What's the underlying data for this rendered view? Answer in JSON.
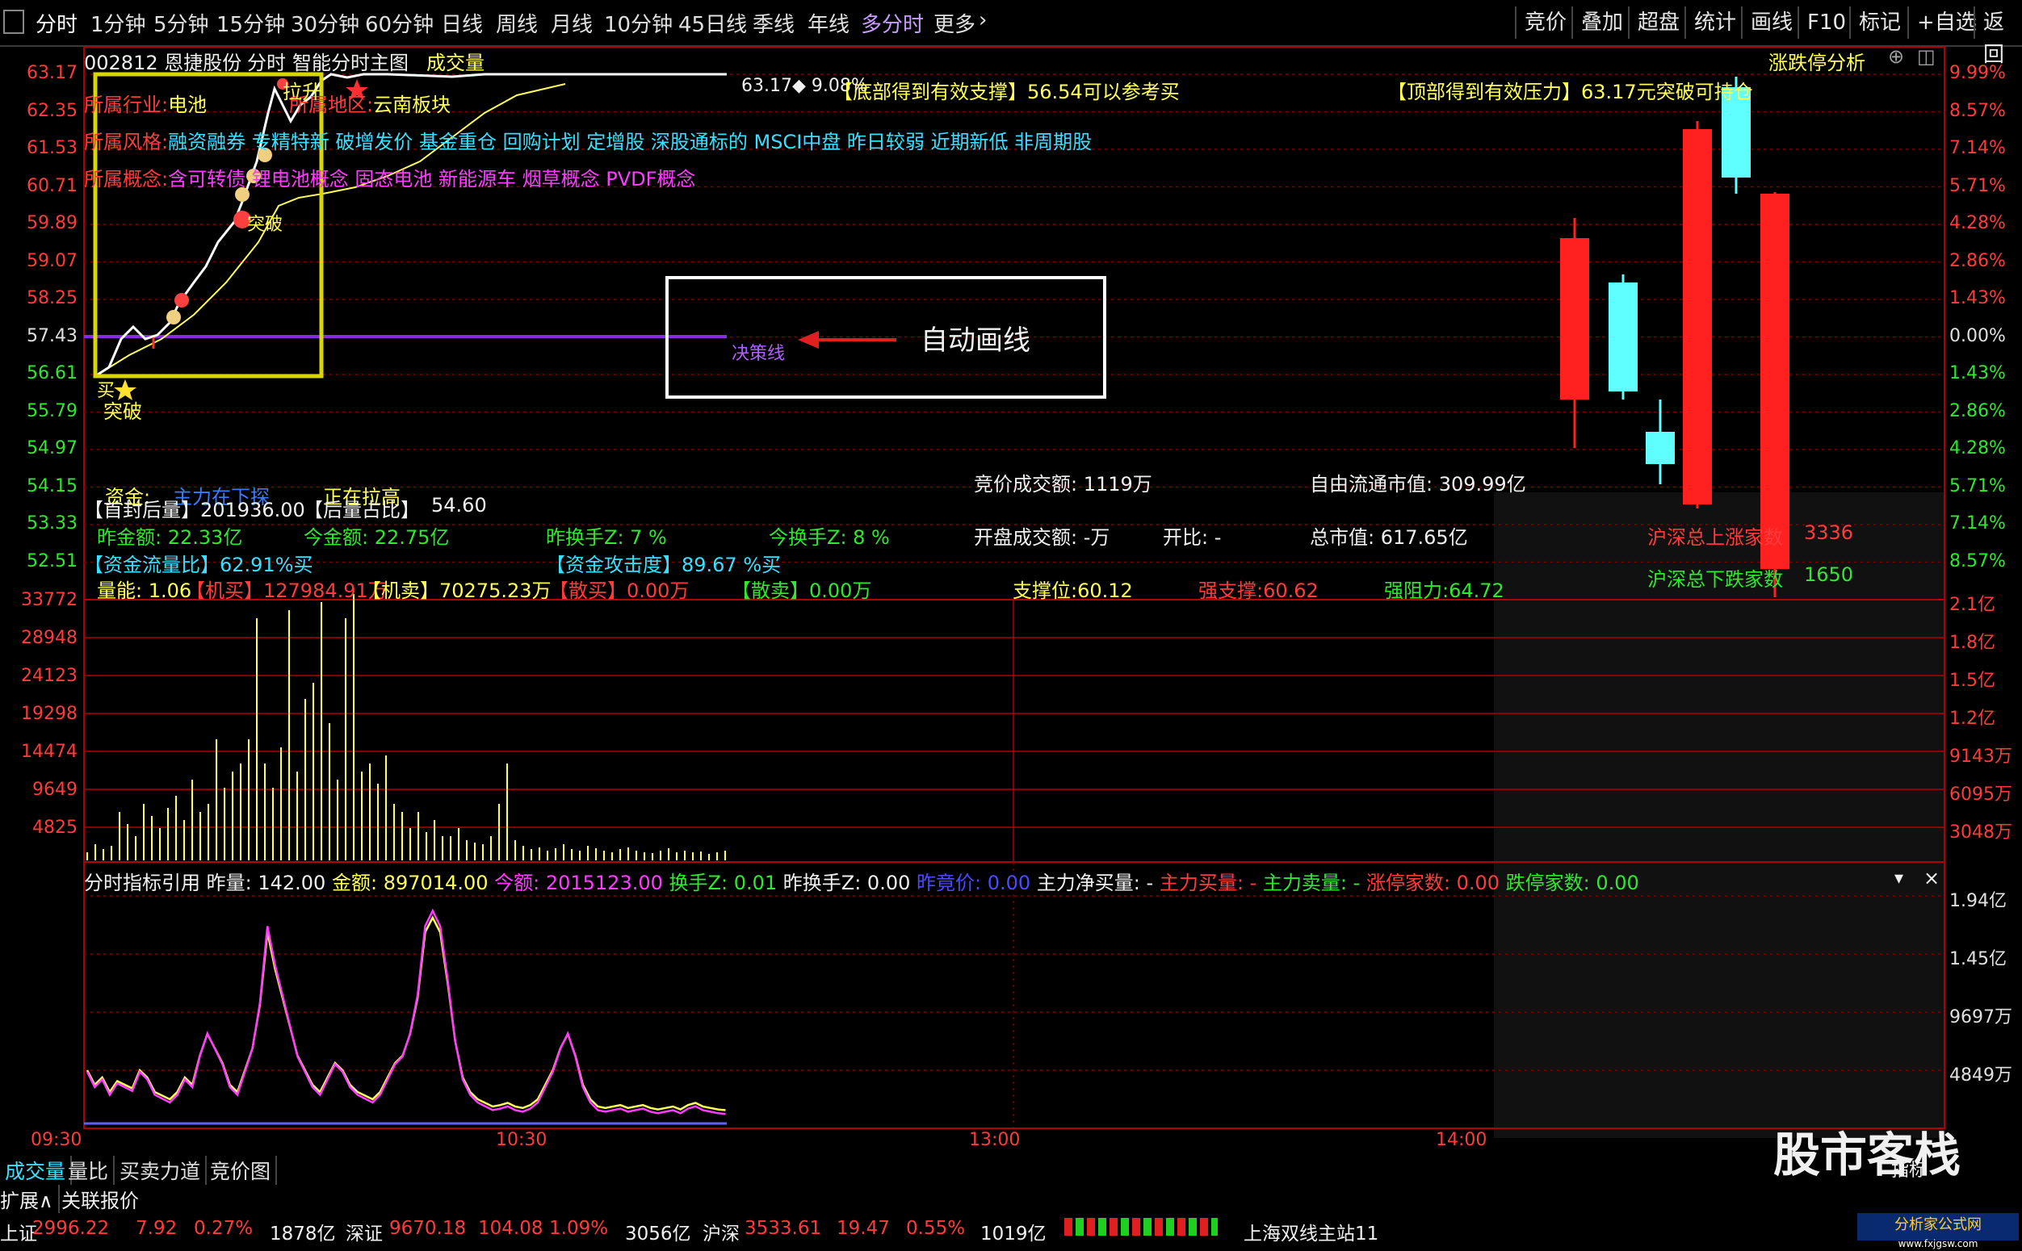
{
  "toolbar": {
    "items": [
      "分时",
      "1分钟",
      "5分钟",
      "15分钟",
      "30分钟",
      "60分钟",
      "日线",
      "周线",
      "月线",
      "10分钟",
      "45日线",
      "季线",
      "年线",
      "多分时",
      "更多"
    ],
    "right_items": [
      "竞价",
      "叠加",
      "超盘",
      "统计",
      "画线",
      "F10",
      "标记",
      "+自选",
      "返回"
    ]
  },
  "header": {
    "stock": "002812 恩捷股份",
    "mode": "分时",
    "main_title": "智能分时主图",
    "volume_tag": "成交量",
    "limit_panel": "涨跌停分析"
  },
  "info": {
    "industry_label": "所属行业:",
    "industry_value": "电池",
    "region_label": "所属地区:",
    "region_value": "云南板块",
    "style_label": "所属风格:",
    "style_value": "融资融券 专精特新 破增发价 基金重仓 回购计划 定增股 深股通标的 MSCI中盘 昨日较弱 近期新低 非周期股",
    "concept_label": "所属概念:",
    "concept_value": "含可转债 锂电池概念 固态电池 新能源车 烟草概念 PVDF概念",
    "price_tag": "63.17◆ 9.08%",
    "support_text": "【底部得到有效支撑】56.54可以参考买",
    "pressure_text": "【顶部得到有效压力】63.17元突破可持仓"
  },
  "annotations": {
    "buy": "买",
    "breakout1": "突破",
    "breakout2": "突破",
    "pull_up": "拉升",
    "decision_line": "决策线",
    "auto_draw": "自动画线"
  },
  "yaxis_left": [
    "63.17",
    "62.35",
    "61.53",
    "60.71",
    "59.89",
    "59.07",
    "58.25",
    "57.43",
    "56.61",
    "55.79",
    "54.97",
    "54.15",
    "53.33",
    "52.51"
  ],
  "yaxis_right": [
    "9.99%",
    "8.57%",
    "7.14%",
    "5.71%",
    "4.28%",
    "2.86%",
    "1.43%",
    "0.00%",
    "1.43%",
    "2.86%",
    "4.28%",
    "5.71%",
    "7.14%",
    "8.57%"
  ],
  "fund_block": {
    "fund_label": "资金:",
    "fund_value": "主力在下探",
    "price_status": "正在拉高",
    "seal_label": "【首封后量】",
    "seal_value": "201936.00",
    "seal_ratio_label": "【后量占比】",
    "seal_ratio_value": "54.60",
    "yesterday_amt": "昨金额: 22.33亿",
    "today_amt": "今金额: 22.75亿",
    "yesterday_turn": "昨换手Z: 7 %",
    "today_turn": "今换手Z: 8 %",
    "flow_ratio": "【资金流量比】62.91%买",
    "attack": "【资金攻击度】89.67 %买",
    "vol_ratio": "量能: 1.06",
    "inst_buy": "【机买】127984.91万",
    "inst_sell": "【机卖】70275.23万",
    "retail_buy": "【散买】0.00万",
    "retail_sell": "【散卖】0.00万",
    "auction_amt": "竞价成交额: 1119万",
    "open_amt": "开盘成交额: -万",
    "open_ratio": "开比: -",
    "float_cap": "自由流通市值: 309.99亿",
    "total_cap": "总市值: 617.65亿",
    "support": "支撑位:60.12",
    "strong_support": "强支撑:60.62",
    "strong_resist": "强阻力:64.72",
    "up_count_label": "沪深总上涨家数",
    "up_count": "3336",
    "down_count_label": "沪深总下跌家数",
    "down_count": "1650"
  },
  "volume_axis_left": [
    "33772",
    "28948",
    "24123",
    "19298",
    "14474",
    "9649",
    "4825"
  ],
  "volume_axis_right": [
    "2.1亿",
    "1.8亿",
    "1.5亿",
    "1.2亿",
    "9143万",
    "6095万",
    "3048万"
  ],
  "indicator": {
    "title": "分时指标引用",
    "yesterday_vol": "昨量: 142.00",
    "amount": "金额: 897014.00",
    "today": "今额: 2015123.00",
    "turnover": "换手Z: 0.01",
    "y_turnover": "昨换手Z: 0.00",
    "auction_price": "昨竟价: 0.00",
    "main_net": "主力净买量: -",
    "main_buy": "主力买量: -",
    "main_sell": "主力卖量: -",
    "limit_up": "涨停家数: 0.00",
    "limit_down": "跌停家数: 0.00",
    "axis_right": [
      "1.94亿",
      "1.45亿",
      "9697万",
      "4849万"
    ]
  },
  "time_axis": [
    "09:30",
    "10:30",
    "13:00",
    "14:00"
  ],
  "bottom_tabs": [
    "成交量",
    "量比",
    "买卖力道",
    "竞价图"
  ],
  "bottom_tabs2": [
    "扩展∧",
    "关联报价"
  ],
  "watermark": "股市客栈",
  "logo_text": "分析家公式网",
  "logo_url": "www.fxjgsw.com",
  "right_tag": "指标",
  "status": {
    "sh_label": "上证",
    "sh_value": "2996.22",
    "sh_change": "7.92",
    "sh_pct": "0.27%",
    "sh_amt": "1878亿",
    "sz_label": "深证",
    "sz_value": "9670.18",
    "sz_change": "104.08",
    "sz_pct": "1.09%",
    "sz_amt": "3056亿",
    "hs_label": "沪深",
    "hs_value": "3533.61",
    "hs_change": "19.47",
    "hs_pct": "0.55%",
    "hs_amt": "1019亿",
    "server": "上海双线主站11"
  },
  "colors": {
    "up": "#ff3b3b",
    "down": "#38e0ff",
    "grid": "#8a0000",
    "avg": "#ffff54",
    "decision": "#8a2be2"
  }
}
